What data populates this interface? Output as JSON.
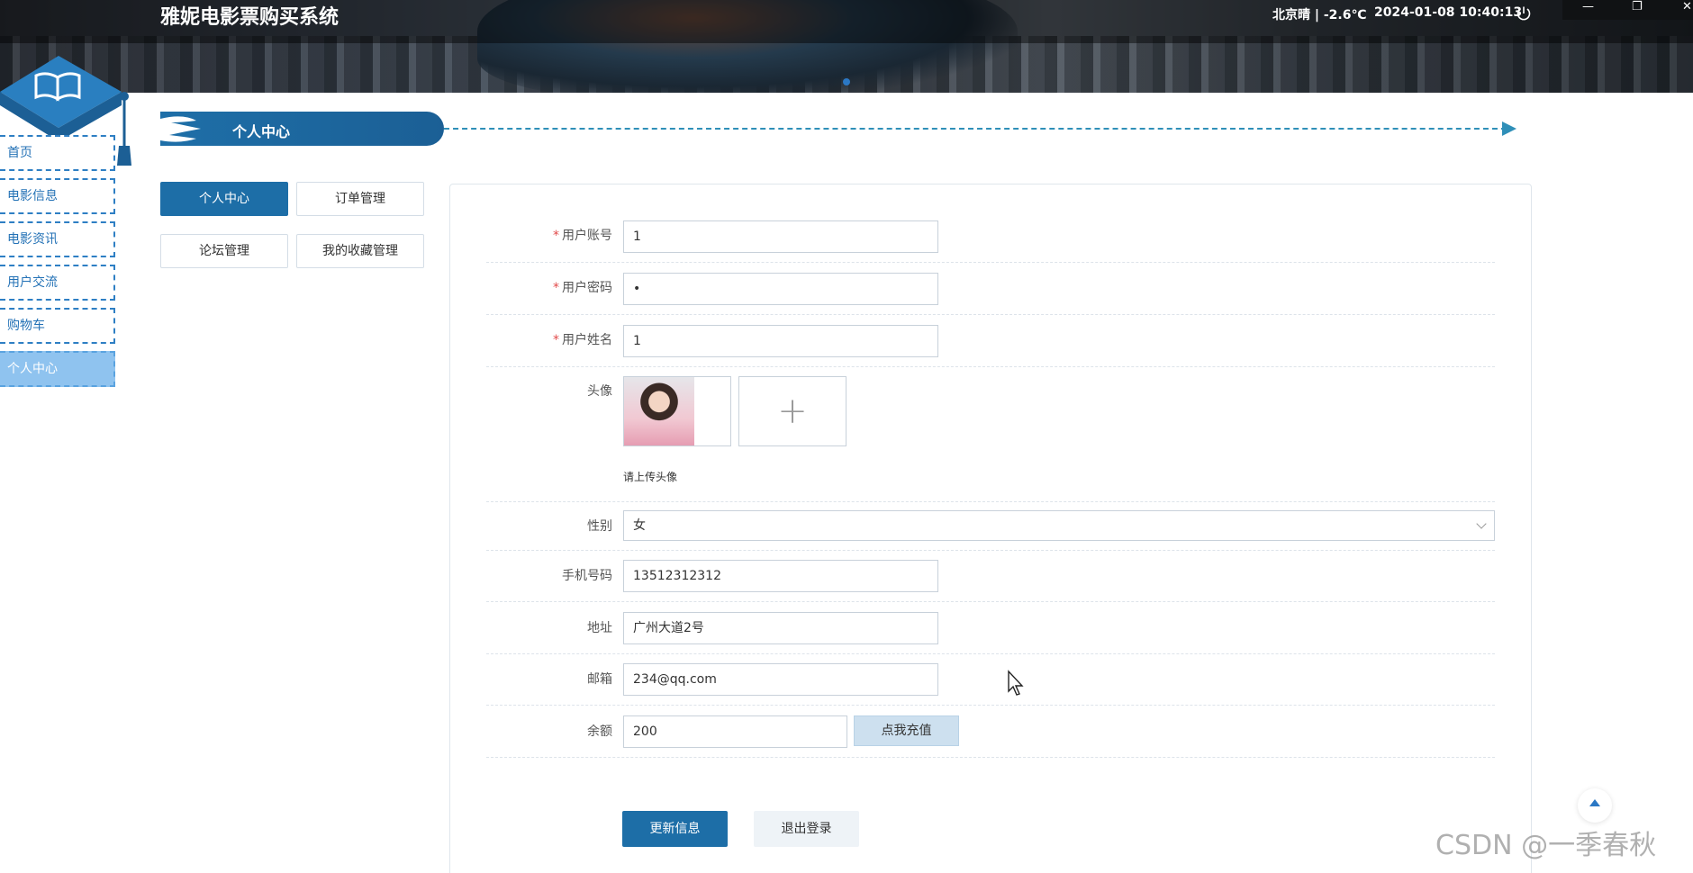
{
  "header": {
    "site_title": "雅妮电影票购买系统",
    "weather": "北京晴 | -2.6℃",
    "datetime": "2024-01-08  10:40:13"
  },
  "sidebar": {
    "items": [
      {
        "label": "首页"
      },
      {
        "label": "电影信息"
      },
      {
        "label": "电影资讯"
      },
      {
        "label": "用户交流"
      },
      {
        "label": "购物车"
      },
      {
        "label": "个人中心",
        "active": true
      }
    ]
  },
  "page": {
    "title": "个人中心"
  },
  "tabs": [
    {
      "label": "个人中心",
      "active": true
    },
    {
      "label": "订单管理"
    },
    {
      "label": "论坛管理"
    },
    {
      "label": "我的收藏管理"
    }
  ],
  "form": {
    "account": {
      "label": "用户账号",
      "value": "1",
      "required": true
    },
    "password": {
      "label": "用户密码",
      "value": "•",
      "required": true
    },
    "name": {
      "label": "用户姓名",
      "value": "1",
      "required": true
    },
    "avatar": {
      "label": "头像",
      "hint": "请上传头像",
      "upload_symbol": "+"
    },
    "gender": {
      "label": "性别",
      "value": "女"
    },
    "phone": {
      "label": "手机号码",
      "value": "13512312312"
    },
    "address": {
      "label": "地址",
      "value": "广州大道2号"
    },
    "email": {
      "label": "邮箱",
      "value": "234@qq.com"
    },
    "balance": {
      "label": "余额",
      "value": "200",
      "recharge_label": "点我充值"
    },
    "required_mark": "*",
    "update_label": "更新信息",
    "logout_label": "退出登录"
  },
  "watermark": "CSDN @一季春秋",
  "colors": {
    "primary": "#1d6ea7",
    "sidebar_border": "#2e7fc4",
    "sidebar_active": "#8fc3ef",
    "required": "#e24b4b"
  }
}
